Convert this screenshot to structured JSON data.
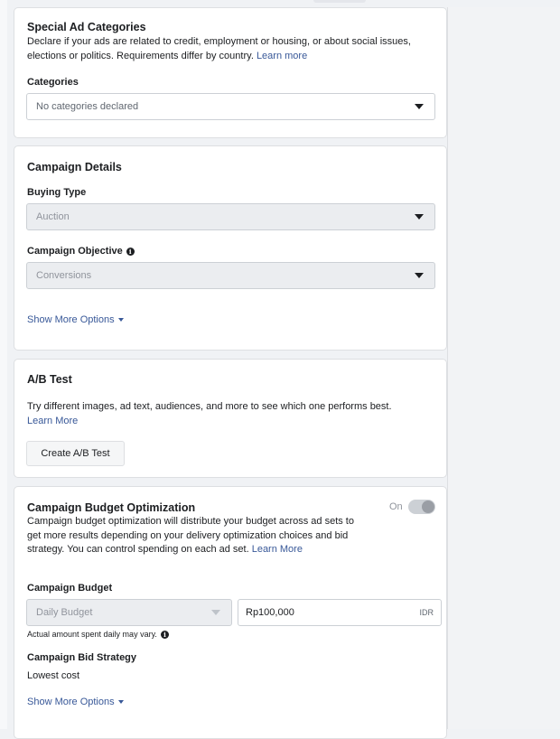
{
  "special_ad": {
    "title": "Special Ad Categories",
    "desc_line1": "Declare if your ads are related to credit, employment or housing, or about social issues,",
    "desc_line2": "elections or politics. Requirements differ by country.",
    "learn_more": "Learn more",
    "categories_label": "Categories",
    "categories_value": "No categories declared"
  },
  "campaign_details": {
    "title": "Campaign Details",
    "buying_type_label": "Buying Type",
    "buying_type_value": "Auction",
    "objective_label": "Campaign Objective",
    "objective_value": "Conversions",
    "show_more": "Show More Options"
  },
  "ab_test": {
    "title": "A/B Test",
    "desc": "Try different images, ad text, audiences, and more to see which one performs best.",
    "learn_more": "Learn More",
    "button": "Create A/B Test"
  },
  "cbo": {
    "title": "Campaign Budget Optimization",
    "toggle_label": "On",
    "desc_line1": "Campaign budget optimization will distribute your budget across ad sets to",
    "desc_line2": "get more results depending on your delivery optimization choices and bid",
    "desc_line3": "strategy. You can control spending on each ad set.",
    "learn_more": "Learn More",
    "budget_label": "Campaign Budget",
    "budget_type": "Daily Budget",
    "budget_value": "Rp100,000",
    "currency": "IDR",
    "budget_note": "Actual amount spent daily may vary.",
    "bid_label": "Campaign Bid Strategy",
    "bid_value": "Lowest cost",
    "show_more": "Show More Options"
  }
}
